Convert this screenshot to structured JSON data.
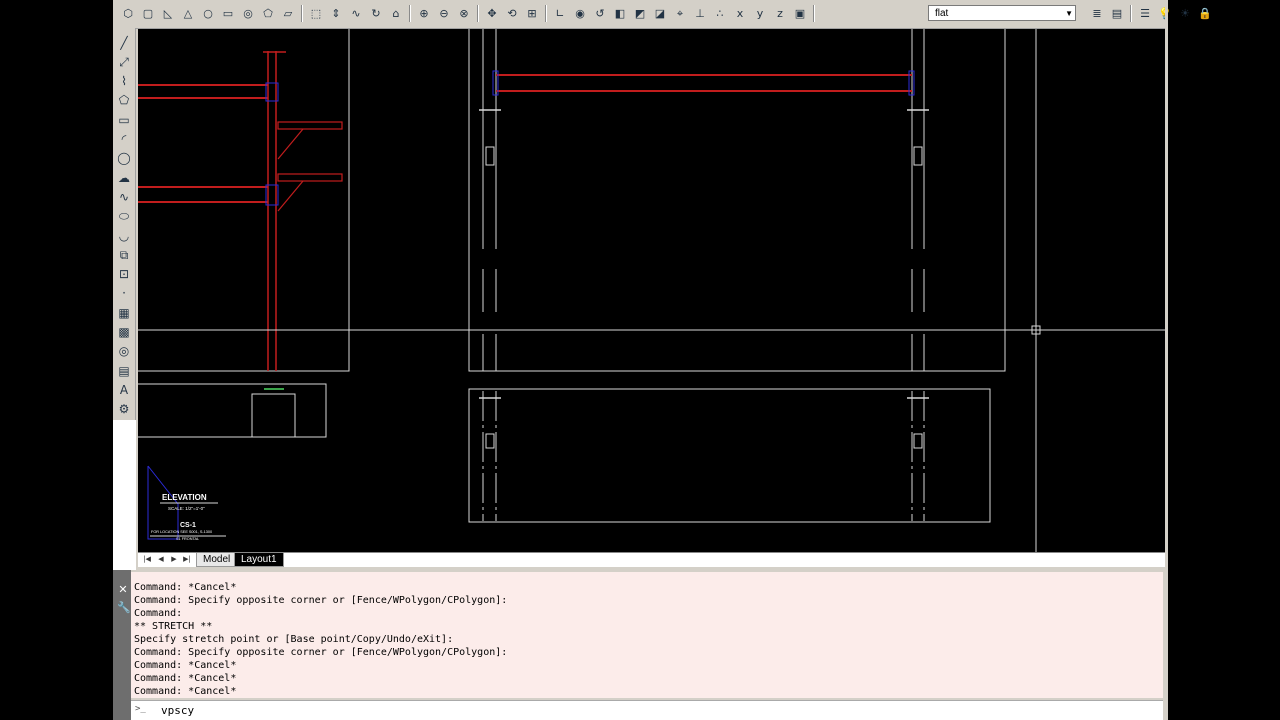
{
  "toolbar": {
    "layer_value": "flat",
    "groups": [
      {
        "icons": [
          "polysolid-icon",
          "box-icon",
          "wedge-icon",
          "cone-icon",
          "sphere-icon",
          "cylinder-icon",
          "torus-icon",
          "pyramid-icon",
          "planar-surface-icon"
        ]
      },
      {
        "icons": [
          "extrude-icon",
          "presspull-icon",
          "sweep-icon",
          "revolve-icon",
          "loft-icon"
        ]
      },
      {
        "icons": [
          "union-icon",
          "subtract-icon",
          "intersect-icon"
        ]
      },
      {
        "icons": [
          "3d-move-icon",
          "3d-rotate-icon",
          "3d-align-icon"
        ]
      },
      {
        "icons": [
          "ucs-icon",
          "ucs-world-icon",
          "ucs-previous-icon",
          "ucs-face-icon",
          "ucs-object-icon",
          "ucs-view-icon",
          "ucs-origin-icon",
          "ucs-zaxis-icon",
          "ucs-3point-icon",
          "ucs-x-icon",
          "ucs-y-icon",
          "ucs-z-icon",
          "ucs-apply-icon"
        ]
      },
      {
        "icons": [
          "layer-properties-icon",
          "layer-state-icon"
        ]
      },
      {
        "icons": [
          "layer-manager-icon",
          "light-bulb-icon",
          "sun-icon",
          "lock-icon"
        ]
      }
    ]
  },
  "left_tools": [
    "line-icon",
    "construction-line-icon",
    "polyline-icon",
    "polygon-icon",
    "rectangle-icon",
    "arc-icon",
    "circle-icon",
    "revision-cloud-icon",
    "spline-icon",
    "ellipse-icon",
    "ellipse-arc-icon",
    "insert-block-icon",
    "make-block-icon",
    "point-icon",
    "hatch-icon",
    "gradient-icon",
    "region-icon",
    "table-icon",
    "multiline-text-icon",
    "add-selected-icon"
  ],
  "tabs": {
    "model": "Model",
    "layout1": "Layout1"
  },
  "drawing": {
    "title": "ELEVATION",
    "scale": "SCALE: 1/2\"=1'-0\"",
    "sheet": "CS-1",
    "note1": "FOR LOCATION SEE S001, S-1300",
    "note2": "S1 FRONTAL"
  },
  "command": {
    "history": [
      "Command: *Cancel*",
      "Command: Specify opposite corner or [Fence/WPolygon/CPolygon]:",
      "Command:",
      "** STRETCH **",
      "Specify stretch point or [Base point/Copy/Undo/eXit]:",
      "Command: Specify opposite corner or [Fence/WPolygon/CPolygon]:",
      "Command: *Cancel*",
      "Command: *Cancel*",
      "Command: *Cancel*"
    ],
    "input_value": "vpscy",
    "prompt_glyph": ">_"
  },
  "colors": {
    "beam_red": "#c21d1d",
    "line_white": "#d8d8d8",
    "connection_blue": "#2b2bd8",
    "history_bg": "#fcecea"
  }
}
